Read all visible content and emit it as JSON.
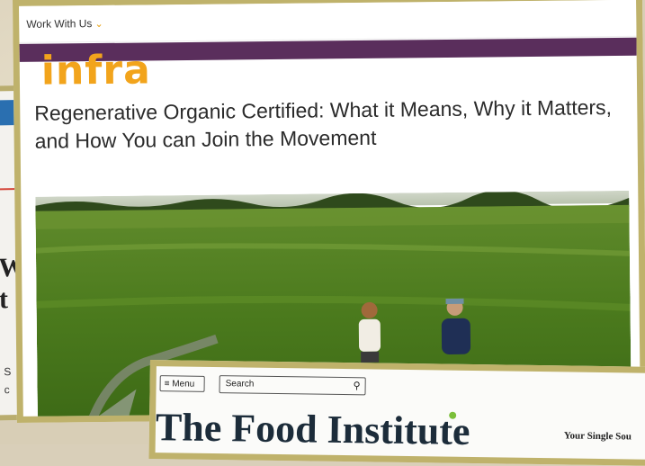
{
  "nav": {
    "work_with_us": "Work With Us",
    "chevron_icon": "chevron-down-icon"
  },
  "logo": {
    "text": "infra",
    "color": "#f2a41c"
  },
  "accent": {
    "purple_bar": "#5a2e5c",
    "frame_gold": "#bfb26b"
  },
  "article": {
    "headline": "Regenerative Organic Certified: What it Means, Why it Matters, and How You can Join the Movement"
  },
  "left_page": {
    "letters": [
      "W",
      "t"
    ],
    "small": [
      "S",
      "c"
    ]
  },
  "food_institute": {
    "menu_label": "≡ Menu",
    "search_label": "Search",
    "search_icon": "search-icon",
    "title": "The Food Institute",
    "tagline": "Your Single Sou"
  }
}
